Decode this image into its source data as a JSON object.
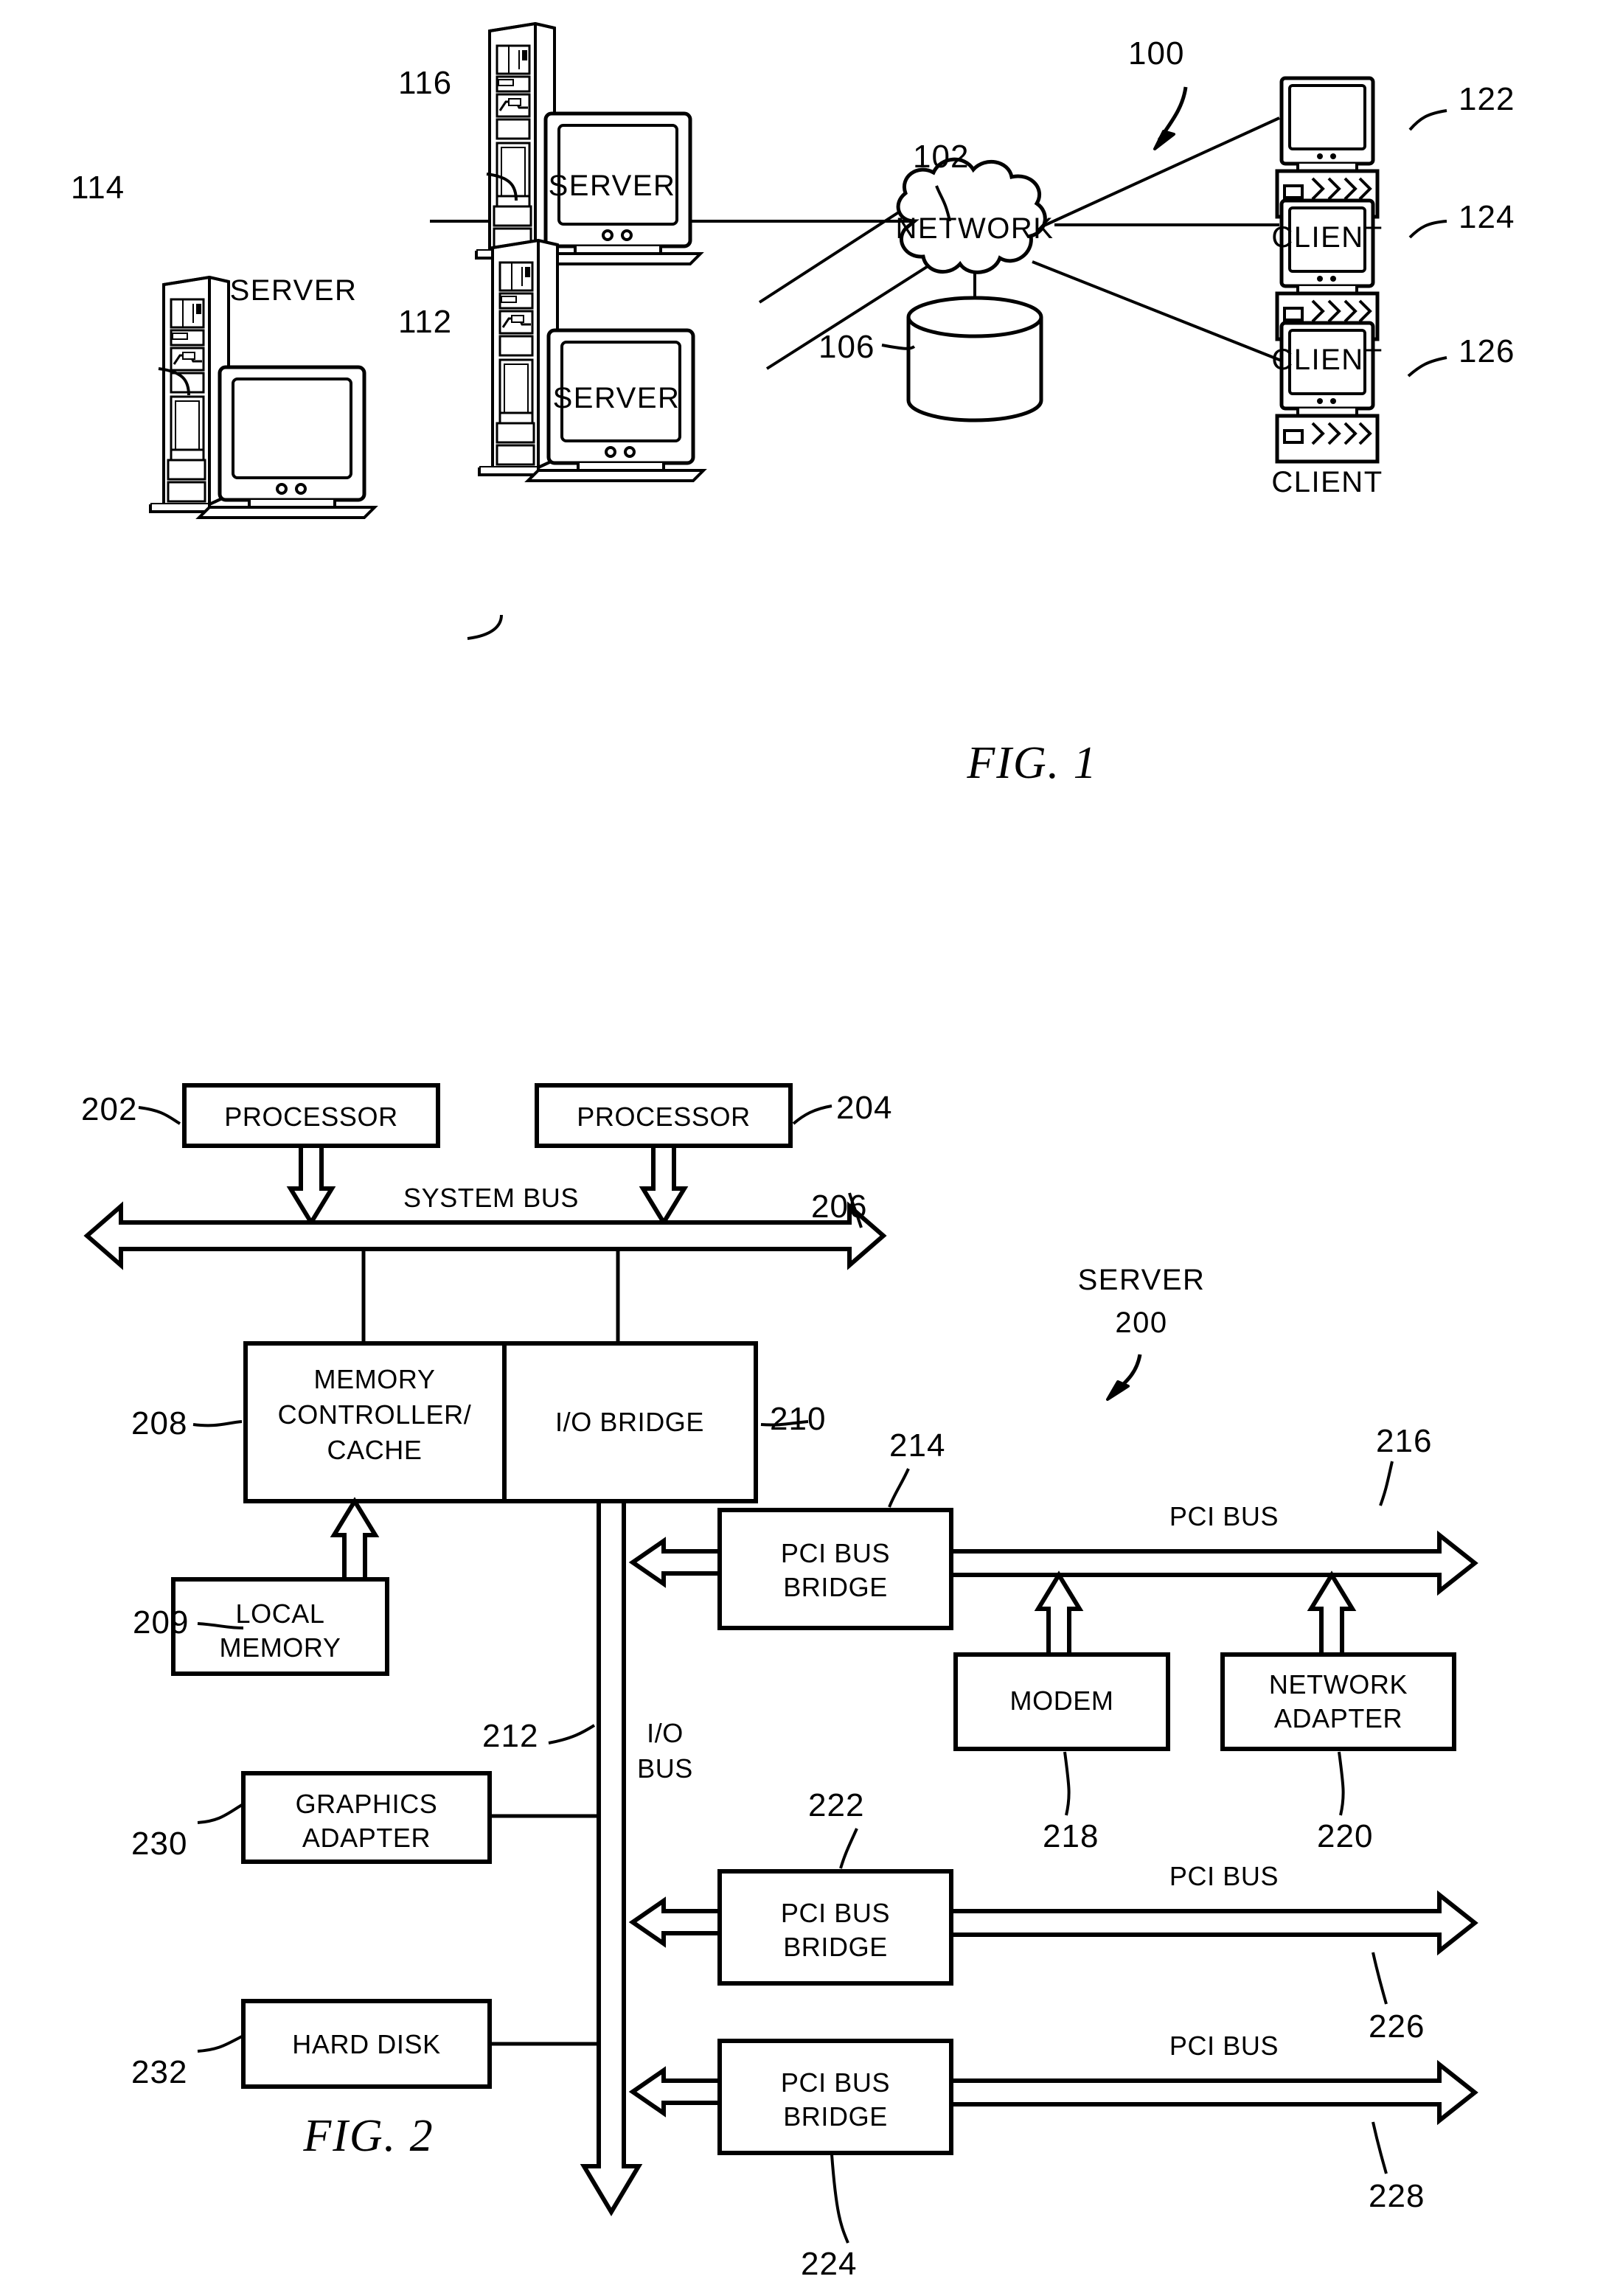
{
  "figures": [
    {
      "id": "fig1",
      "caption": "FIG. 1",
      "system_ref": "100",
      "nodes": {
        "network": {
          "label": "NETWORK",
          "ref": "102"
        },
        "storage": {
          "ref": "106"
        },
        "server_left": {
          "label": "SERVER",
          "ref": "114"
        },
        "server_top": {
          "label": "SERVER",
          "ref": "116"
        },
        "server_bottom": {
          "label": "SERVER",
          "ref": "112"
        },
        "client_top": {
          "label": "CLIENT",
          "ref": "122"
        },
        "client_mid": {
          "label": "CLIENT",
          "ref": "124"
        },
        "client_bottom": {
          "label": "CLIENT",
          "ref": "126"
        }
      }
    },
    {
      "id": "fig2",
      "caption": "FIG. 2",
      "system_label": "SERVER",
      "system_ref": "200",
      "blocks": [
        {
          "key": "processor_1",
          "label": "PROCESSOR",
          "ref": "202"
        },
        {
          "key": "processor_2",
          "label": "PROCESSOR",
          "ref": "204"
        },
        {
          "key": "memory_controller_cache",
          "label": "MEMORY\nCONTROLLER/\nCACHE",
          "ref": "208"
        },
        {
          "key": "io_bridge",
          "label": "I/O BRIDGE",
          "ref": "210"
        },
        {
          "key": "local_memory",
          "label": "LOCAL\nMEMORY",
          "ref": "209"
        },
        {
          "key": "pci_bus_bridge_1",
          "label": "PCI BUS\nBRIDGE",
          "ref": "214"
        },
        {
          "key": "modem",
          "label": "MODEM",
          "ref": "218"
        },
        {
          "key": "network_adapter",
          "label": "NETWORK\nADAPTER",
          "ref": "220"
        },
        {
          "key": "pci_bus_bridge_2",
          "label": "PCI BUS\nBRIDGE",
          "ref": "222"
        },
        {
          "key": "pci_bus_bridge_3",
          "label": "PCI BUS\nBRIDGE",
          "ref": "224"
        },
        {
          "key": "graphics_adapter",
          "label": "GRAPHICS\nADAPTER",
          "ref": "230"
        },
        {
          "key": "hard_disk",
          "label": "HARD DISK",
          "ref": "232"
        }
      ],
      "buses": [
        {
          "key": "system_bus",
          "label": "SYSTEM BUS",
          "ref": "206"
        },
        {
          "key": "io_bus",
          "label": "I/O\nBUS",
          "ref": "212"
        },
        {
          "key": "pci_bus_1",
          "label": "PCI BUS",
          "ref": "216"
        },
        {
          "key": "pci_bus_2",
          "label": "PCI BUS",
          "ref": "226"
        },
        {
          "key": "pci_bus_3",
          "label": "PCI BUS",
          "ref": "228"
        }
      ]
    }
  ],
  "fig1": {
    "caption": "FIG. 1",
    "ref_100": "100",
    "ref_102": "102",
    "ref_106": "106",
    "ref_112": "112",
    "ref_114": "114",
    "ref_116": "116",
    "ref_122": "122",
    "ref_124": "124",
    "ref_126": "126",
    "network_label": "NETWORK",
    "server_114_label": "SERVER",
    "server_116_label": "SERVER",
    "server_112_label": "SERVER",
    "client_122_label": "CLIENT",
    "client_124_label": "CLIENT",
    "client_126_label": "CLIENT"
  },
  "fig2": {
    "caption": "FIG. 2",
    "server_label": "SERVER",
    "server_ref": "200",
    "processor_1": "PROCESSOR",
    "processor_2": "PROCESSOR",
    "ref_202": "202",
    "ref_204": "204",
    "system_bus": "SYSTEM BUS",
    "ref_206": "206",
    "memory_controller_l1": "MEMORY",
    "memory_controller_l2": "CONTROLLER/",
    "memory_controller_l3": "CACHE",
    "ref_208": "208",
    "io_bridge": "I/O BRIDGE",
    "ref_210": "210",
    "local_memory_l1": "LOCAL",
    "local_memory_l2": "MEMORY",
    "ref_209": "209",
    "io_bus_l1": "I/O",
    "io_bus_l2": "BUS",
    "ref_212": "212",
    "pci_bridge_1_l1": "PCI BUS",
    "pci_bridge_1_l2": "BRIDGE",
    "ref_214": "214",
    "pci_bus_1": "PCI BUS",
    "ref_216": "216",
    "modem": "MODEM",
    "ref_218": "218",
    "network_adapter_l1": "NETWORK",
    "network_adapter_l2": "ADAPTER",
    "ref_220": "220",
    "pci_bridge_2_l1": "PCI BUS",
    "pci_bridge_2_l2": "BRIDGE",
    "ref_222": "222",
    "pci_bus_2": "PCI BUS",
    "ref_226": "226",
    "pci_bridge_3_l1": "PCI BUS",
    "pci_bridge_3_l2": "BRIDGE",
    "ref_224": "224",
    "pci_bus_3": "PCI BUS",
    "ref_228": "228",
    "graphics_adapter_l1": "GRAPHICS",
    "graphics_adapter_l2": "ADAPTER",
    "ref_230": "230",
    "hard_disk": "HARD DISK",
    "ref_232": "232"
  }
}
